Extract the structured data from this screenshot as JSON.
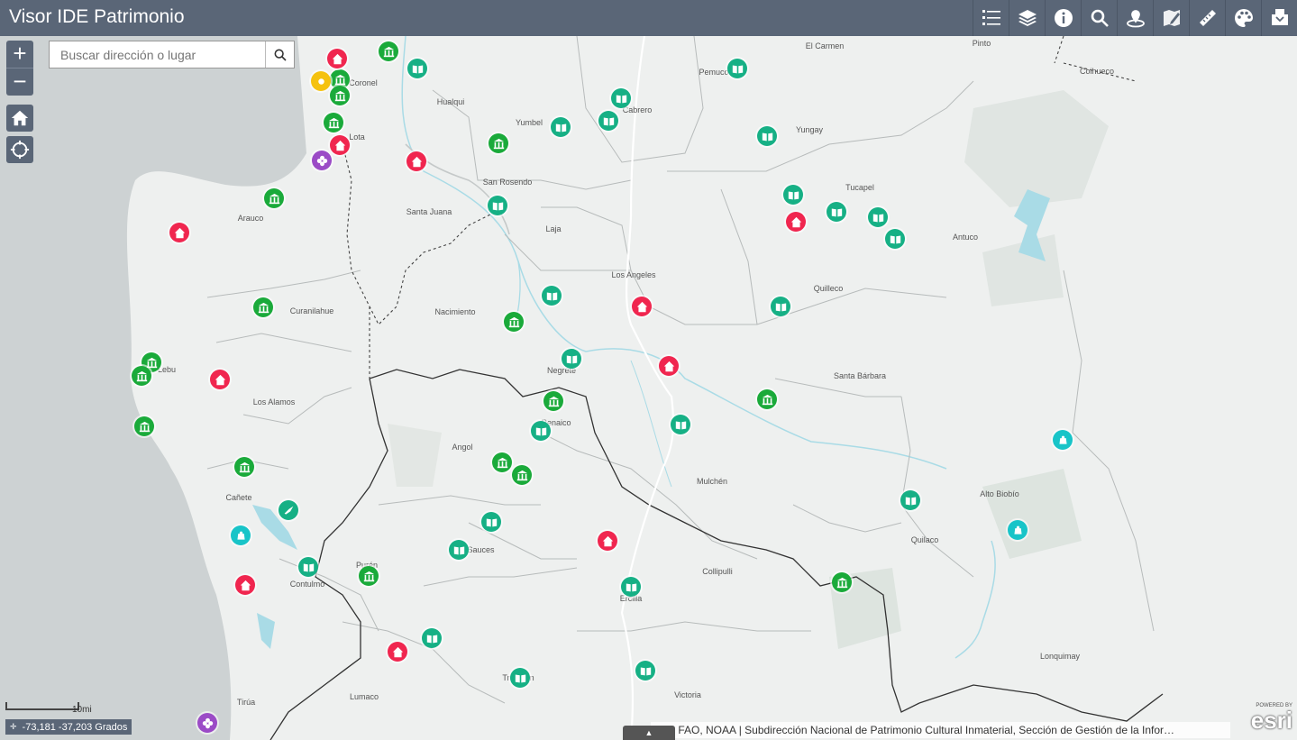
{
  "app": {
    "title": "Visor IDE Patrimonio"
  },
  "toolbar": [
    {
      "name": "legend-icon"
    },
    {
      "name": "layers-icon"
    },
    {
      "name": "info-icon"
    },
    {
      "name": "search-icon"
    },
    {
      "name": "location-icon"
    },
    {
      "name": "edit-map-icon"
    },
    {
      "name": "measure-icon"
    },
    {
      "name": "palette-icon"
    },
    {
      "name": "print-icon"
    }
  ],
  "controls": {
    "zoom_in": "+",
    "zoom_out": "−"
  },
  "search": {
    "placeholder": "Buscar dirección o lugar"
  },
  "scale": {
    "label": "10mi"
  },
  "coords": {
    "text": "-73,181 -37,203 Grados"
  },
  "attribution": {
    "text": "Esri, FAO, NOAA | Subdirección Nacional de Patrimonio Cultural Inmaterial, Sección de Gestión de la Infor…"
  },
  "esri": {
    "powered": "POWERED BY",
    "logo": "esri"
  },
  "colors": {
    "header": "#5a6677",
    "green": "#1aaa3a",
    "teal": "#16b085",
    "red": "#f0264f",
    "cyan": "#18c4c8",
    "purple": "#9b4bc6",
    "yellow": "#f5c20f"
  },
  "places": [
    "El Carmen",
    "Pinto",
    "Coihueco",
    "Pemuco",
    "Coronel",
    "Hualqui",
    "Cabrero",
    "Yumbel",
    "Yungay",
    "Lota",
    "San Rosendo",
    "Tucapel",
    "Arauco",
    "Santa Juana",
    "Laja",
    "Antuco",
    "Los Angeles",
    "Quilleco",
    "Curanilahue",
    "Nacimiento",
    "Lebu",
    "Negrete",
    "Santa Bárbara",
    "Los Alamos",
    "Renaico",
    "Angol",
    "Mulchén",
    "Cañete",
    "Alto Biobío",
    "Los Sauces",
    "Quilaco",
    "Collipulli",
    "Purén",
    "Contulmo",
    "Ercilla",
    "Lonquimay",
    "Traiguén",
    "Victoria",
    "Lumaco",
    "Tirúa"
  ]
}
